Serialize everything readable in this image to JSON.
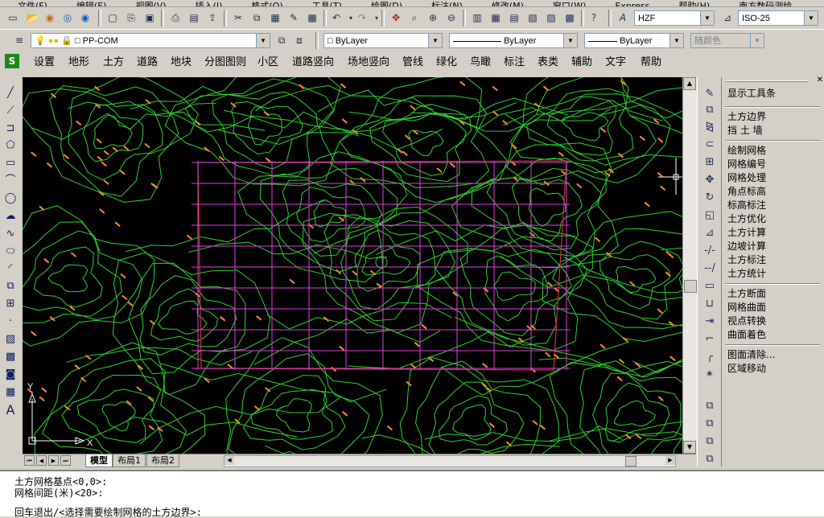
{
  "menubar": {
    "items": [
      "文件(F)",
      "编辑(E)",
      "视图(V)",
      "插入(I)",
      "格式(O)",
      "工具(T)",
      "绘图(D)",
      "标注(N)",
      "修改(M)",
      "窗口(W)",
      "Express",
      "帮助(H)",
      "南方数码测绘"
    ]
  },
  "toolbar": {
    "text_style": "HZF",
    "dim_style": "ISO-25",
    "layer": "PP-COM",
    "color": "ByLayer",
    "linetype": "ByLayer",
    "lineweight": "ByLayer",
    "plotstyle": "随颜色"
  },
  "custom_menu": {
    "items": [
      "设置",
      "地形",
      "土方",
      "道路",
      "地块",
      "分图图则",
      "小区",
      "道路竖向",
      "场地竖向",
      "管线",
      "绿化",
      "鸟瞰",
      "标注",
      "表类",
      "辅助",
      "文字",
      "帮助"
    ]
  },
  "tabs": {
    "model": "模型",
    "layout1": "布局1",
    "layout2": "布局2"
  },
  "ucs": {
    "y": "Y",
    "x": "X"
  },
  "right_panel": {
    "title": "显示工具条",
    "group1": [
      "土方边界",
      "挡 土 墙"
    ],
    "group2": [
      "绘制网格",
      "网格编号",
      "网格处理",
      "角点标高",
      "标高标注",
      "土方优化",
      "土方计算",
      "边坡计算",
      "土方标注",
      "土方统计"
    ],
    "group3": [
      "土方断面",
      "网格曲面",
      "视点转换",
      "曲面着色"
    ],
    "group4": [
      "图面清除...",
      "区域移动"
    ]
  },
  "command_line": {
    "lines": [
      "土方网格基点<0,0>:",
      "网格间距(米)<20>:",
      "回车退出/<选择需要绘制网格的土方边界>:"
    ]
  },
  "colors": {
    "contour": "#2fd12f",
    "grid": "#e040e0",
    "boundary": "#d03030",
    "label": "#ff8a2a",
    "canvas": "#000000"
  }
}
